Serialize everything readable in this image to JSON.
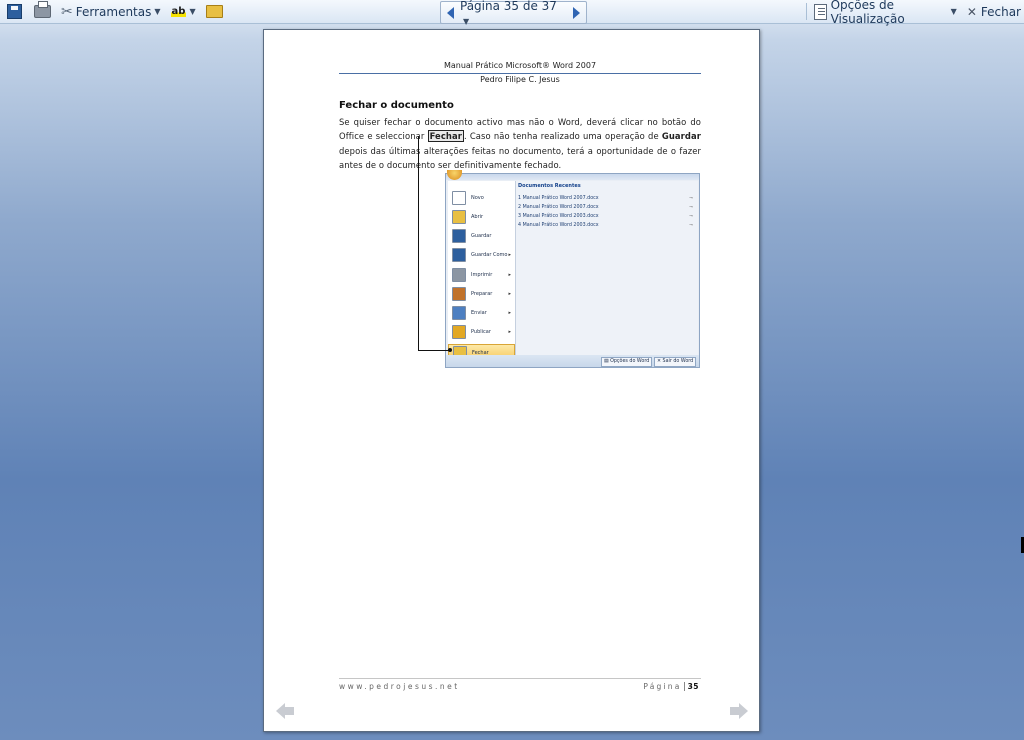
{
  "toolbar": {
    "tools_label": "Ferramentas",
    "abc_label": "ab",
    "page_indicator": "Página 35 de 37",
    "view_options_label": "Opções de Visualização",
    "close_label": "Fechar"
  },
  "document": {
    "header_title": "Manual Prático Microsoft® Word 2007",
    "header_author": "Pedro Filipe C. Jesus",
    "section_title": "Fechar o documento",
    "para_part1": "Se quiser fechar o documento activo mas não o Word, deverá clicar no botão do Office e seleccionar ",
    "para_boxed": "Fechar",
    "para_part2": ". Caso não tenha realizado uma operação de ",
    "para_bold": "Guardar",
    "para_part3": " depois das últimas alterações feitas no documento, terá a oportunidade de o fazer antes de o documento ser definitivamente fechado.",
    "footer_site": "www.pedrojesus.net",
    "footer_page_label": "Página",
    "footer_page_number": "35"
  },
  "office_menu": {
    "items": [
      {
        "label": "Novo",
        "has_arrow": false,
        "color": "#ffffff"
      },
      {
        "label": "Abrir",
        "has_arrow": false,
        "color": "#e8bf42"
      },
      {
        "label": "Guardar",
        "has_arrow": false,
        "color": "#2d5f9e"
      },
      {
        "label": "Guardar Como",
        "has_arrow": true,
        "color": "#2d5f9e"
      },
      {
        "label": "Imprimir",
        "has_arrow": true,
        "color": "#8c96a3"
      },
      {
        "label": "Preparar",
        "has_arrow": true,
        "color": "#c0722b"
      },
      {
        "label": "Enviar",
        "has_arrow": true,
        "color": "#4d7fc1"
      },
      {
        "label": "Publicar",
        "has_arrow": true,
        "color": "#e2a824"
      },
      {
        "label": "Fechar",
        "has_arrow": false,
        "color": "#e8bf42"
      }
    ],
    "recent_title": "Documentos Recentes",
    "recent": [
      "1  Manual Prático Word 2007.docx",
      "2  Manual Prático Word 2007.docx",
      "3  Manual Prático Word 2003.docx",
      "4  Manual Prático Word 2003.docx"
    ],
    "word_options_label": "Opções do Word",
    "exit_word_label": "Sair do Word"
  }
}
